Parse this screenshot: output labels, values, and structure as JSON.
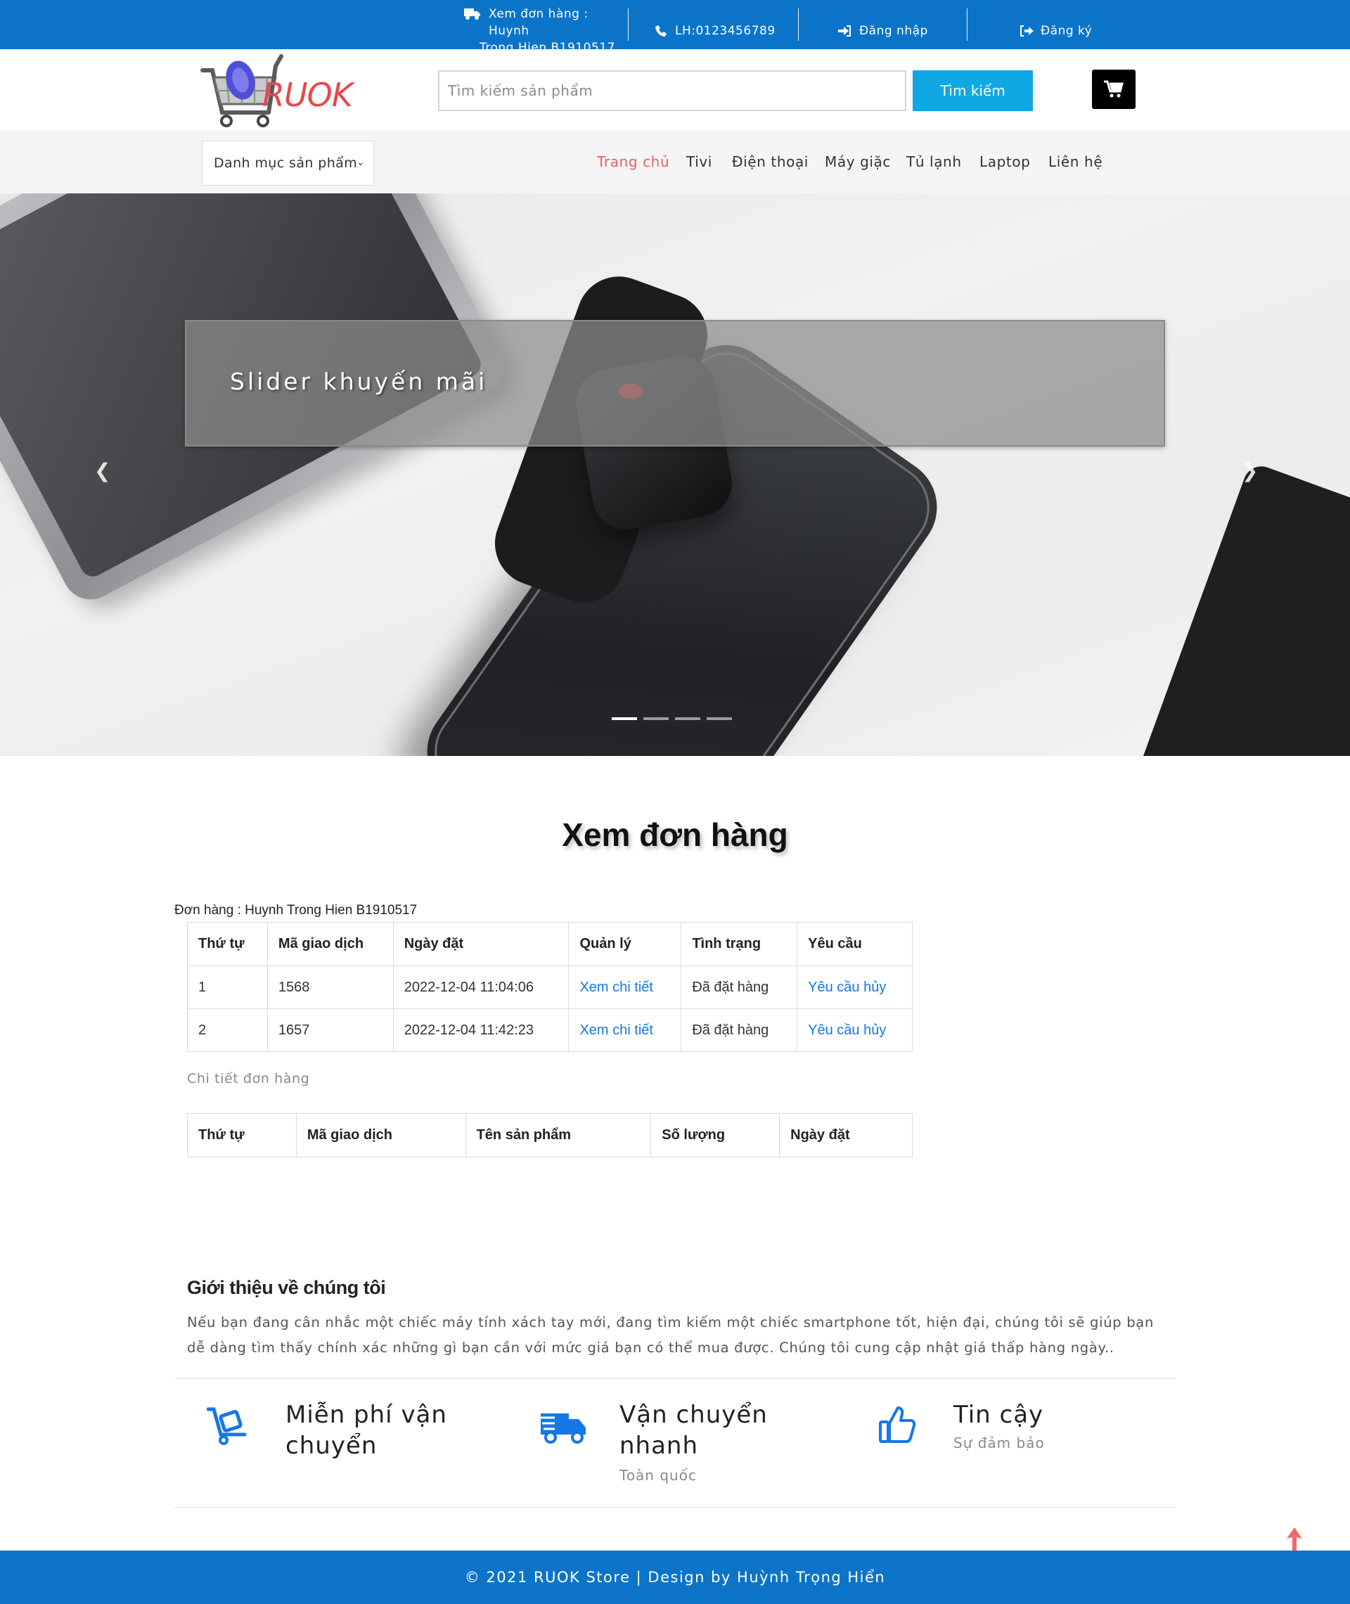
{
  "topbar": {
    "order_line1": "Xem đơn hàng : Huynh",
    "order_line2": "Trong Hien B1910517",
    "phone": "LH:0123456789",
    "login": "Đăng nhập",
    "signup": "Đăng ký"
  },
  "header": {
    "logo_text": "RUOK",
    "search_placeholder": "Tìm kiếm sản phẩm",
    "search_button": "Tìm kiếm"
  },
  "nav": {
    "category_select": "Danh mục sản phẩm",
    "links": [
      "Trang chủ",
      "Tivi",
      "Điện thoại",
      "Máy giặc",
      "Tủ lạnh",
      "Laptop",
      "Liên hệ"
    ],
    "active_index": 0
  },
  "slider": {
    "caption": "Slider khuyến mãi",
    "slide_count": 4,
    "active_slide": 0
  },
  "main": {
    "title": "Xem đơn hàng",
    "order_owner": "Đơn hàng : Huynh Trong Hien B1910517",
    "orders_table": {
      "headers": [
        "Thứ tự",
        "Mã giao dịch",
        "Ngày đặt",
        "Quản lý",
        "Tình trạng",
        "Yêu cầu"
      ],
      "rows": [
        [
          "1",
          "1568",
          "2022-12-04 11:04:06",
          "Xem chi tiết",
          "Đã đặt hàng",
          "Yêu cầu hủy"
        ],
        [
          "2",
          "1657",
          "2022-12-04 11:42:23",
          "Xem chi tiết",
          "Đã đặt hàng",
          "Yêu cầu hủy"
        ]
      ]
    },
    "details_label": "Chi tiết đơn hàng",
    "details_table": {
      "headers": [
        "Thứ tự",
        "Mã giao dịch",
        "Tên sản phẩm",
        "Số lượng",
        "Ngày đặt"
      ]
    }
  },
  "about": {
    "title": "Giới thiệu về chúng tôi",
    "text": "Nếu bạn đang cân nhắc một chiếc máy tính xách tay mới, đang tìm kiếm một chiếc smartphone tốt, hiện đại, chúng tôi sẽ giúp bạn dễ dàng tìm thấy chính xác những gì bạn cần với mức giá bạn có thể mua được. Chúng tôi cung cập nhật giá thấp hàng ngày.."
  },
  "features": [
    {
      "title_line1": "Miễn phí vận",
      "title_line2": "chuyển",
      "subtitle": "",
      "icon": "dolly-icon"
    },
    {
      "title_line1": "Vận chuyển",
      "title_line2": "nhanh",
      "subtitle": "Toàn quốc",
      "icon": "truck-icon"
    },
    {
      "title_line1": "Tin cậy",
      "title_line2": "",
      "subtitle": "Sự đảm bảo",
      "icon": "thumbs-up-icon"
    }
  ],
  "footer": {
    "text": "© 2021 RUOK Store | Design by Huỳnh Trọng Hiển"
  },
  "colors": {
    "brand_blue": "#0b74c9",
    "search_button": "#10a8e4",
    "link_blue": "#1677e6",
    "accent_red": "#e8484a"
  }
}
